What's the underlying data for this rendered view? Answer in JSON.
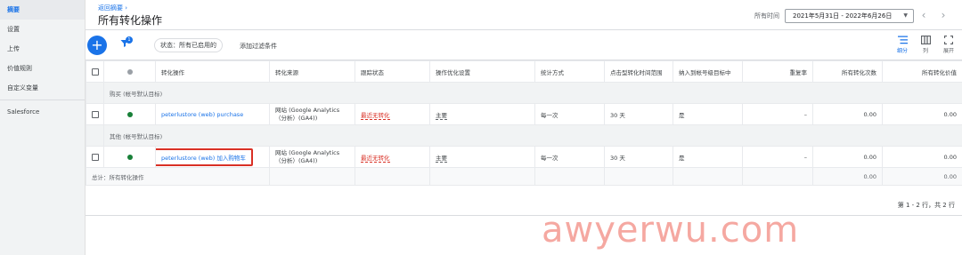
{
  "sidebar": {
    "items": [
      {
        "label": "摘要",
        "active": true
      },
      {
        "label": "设置"
      },
      {
        "label": "上传"
      },
      {
        "label": "价值规则"
      },
      {
        "label": "自定义变量"
      },
      {
        "label": "Salesforce"
      }
    ]
  },
  "header": {
    "back_link": "返回摘要",
    "title": "所有转化操作",
    "range_label": "所有时间",
    "date_range": "2021年5月31日 - 2022年6月26日"
  },
  "toolbar": {
    "filter_badge": "1",
    "status_chip": "状态：所有已启用的",
    "add_filter": "添加过滤条件",
    "segment_label": "细分",
    "columns_label": "列",
    "expand_label": "展开"
  },
  "table": {
    "headers": {
      "action": "转化操作",
      "source": "转化来源",
      "tracking": "跟踪状态",
      "optimization": "操作优化设置",
      "counting": "统计方式",
      "click_window": "点击型转化时间范围",
      "include": "纳入到帐号级目标中",
      "repeat": "重复率",
      "all_conv": "所有转化次数",
      "all_value": "所有转化价值"
    },
    "groups": [
      {
        "label": "购买 (帐号默认目标)",
        "rows": [
          {
            "status_color": "#188038",
            "action": "peterlustore (web) purchase",
            "source": "网站 (Google Analytics（分析）(GA4))",
            "tracking": "最近无转化",
            "optimization": "主要",
            "counting": "每一次",
            "click_window": "30 天",
            "include": "是",
            "repeat": "–",
            "all_conv": "0.00",
            "all_value": "0.00",
            "highlighted": false
          }
        ]
      },
      {
        "label": "其他 (帐号默认目标)",
        "rows": [
          {
            "status_color": "#188038",
            "action": "peterlustore (web) 加入购物车",
            "source": "网站 (Google Analytics（分析）(GA4))",
            "tracking": "最近无转化",
            "optimization": "主要",
            "counting": "每一次",
            "click_window": "30 天",
            "include": "是",
            "repeat": "–",
            "all_conv": "0.00",
            "all_value": "0.00",
            "highlighted": true
          }
        ]
      }
    ],
    "total": {
      "label": "总计：所有转化操作",
      "all_conv": "0.00",
      "all_value": "0.00"
    }
  },
  "pagination": "第 1 - 2 行，共 2 行",
  "watermark": "awyerwu.com",
  "colors": {
    "accent": "#1a73e8",
    "status_red": "#d93025",
    "status_green": "#188038",
    "sidebar_bg": "#f1f3f4"
  }
}
